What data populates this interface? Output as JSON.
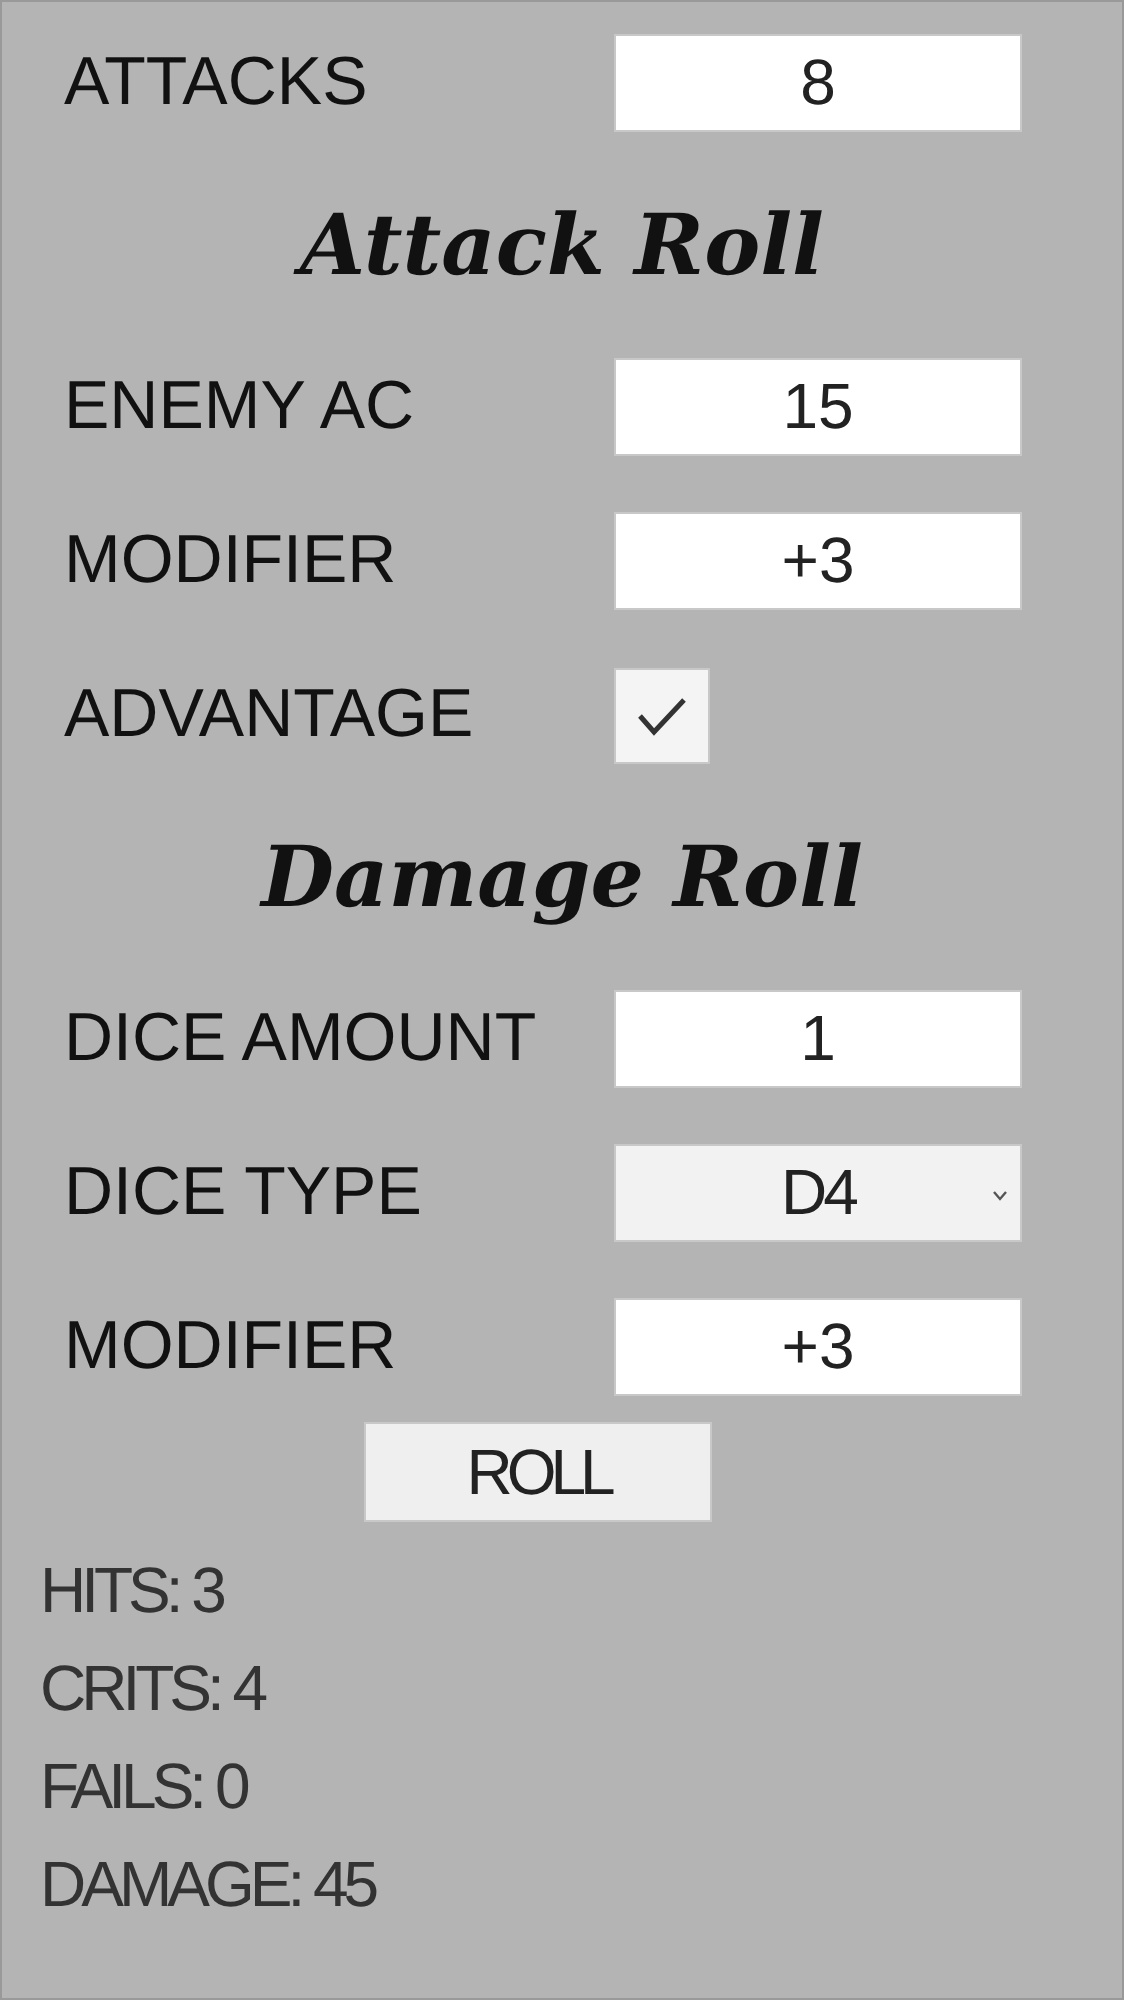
{
  "items": [
    {
      "kind": "input",
      "label": "ATTACKS",
      "value": "8"
    },
    {
      "kind": "heading",
      "label": "Attack Roll"
    },
    {
      "kind": "input",
      "label": "ENEMY AC",
      "value": "15"
    },
    {
      "kind": "input",
      "label": "MODIFIER",
      "value": "+3"
    },
    {
      "kind": "checkbox",
      "label": "ADVANTAGE",
      "checked": true
    },
    {
      "kind": "heading",
      "label": "Damage Roll"
    },
    {
      "kind": "input",
      "label": "DICE AMOUNT",
      "value": "1"
    },
    {
      "kind": "select",
      "label": "DICE TYPE",
      "value": "D4"
    },
    {
      "kind": "input",
      "label": "MODIFIER",
      "value": "+3"
    }
  ],
  "roll_button": "ROLL",
  "results": [
    "HITS: 3",
    "CRITS: 4",
    "FAILS: 0",
    "DAMAGE: 45"
  ]
}
